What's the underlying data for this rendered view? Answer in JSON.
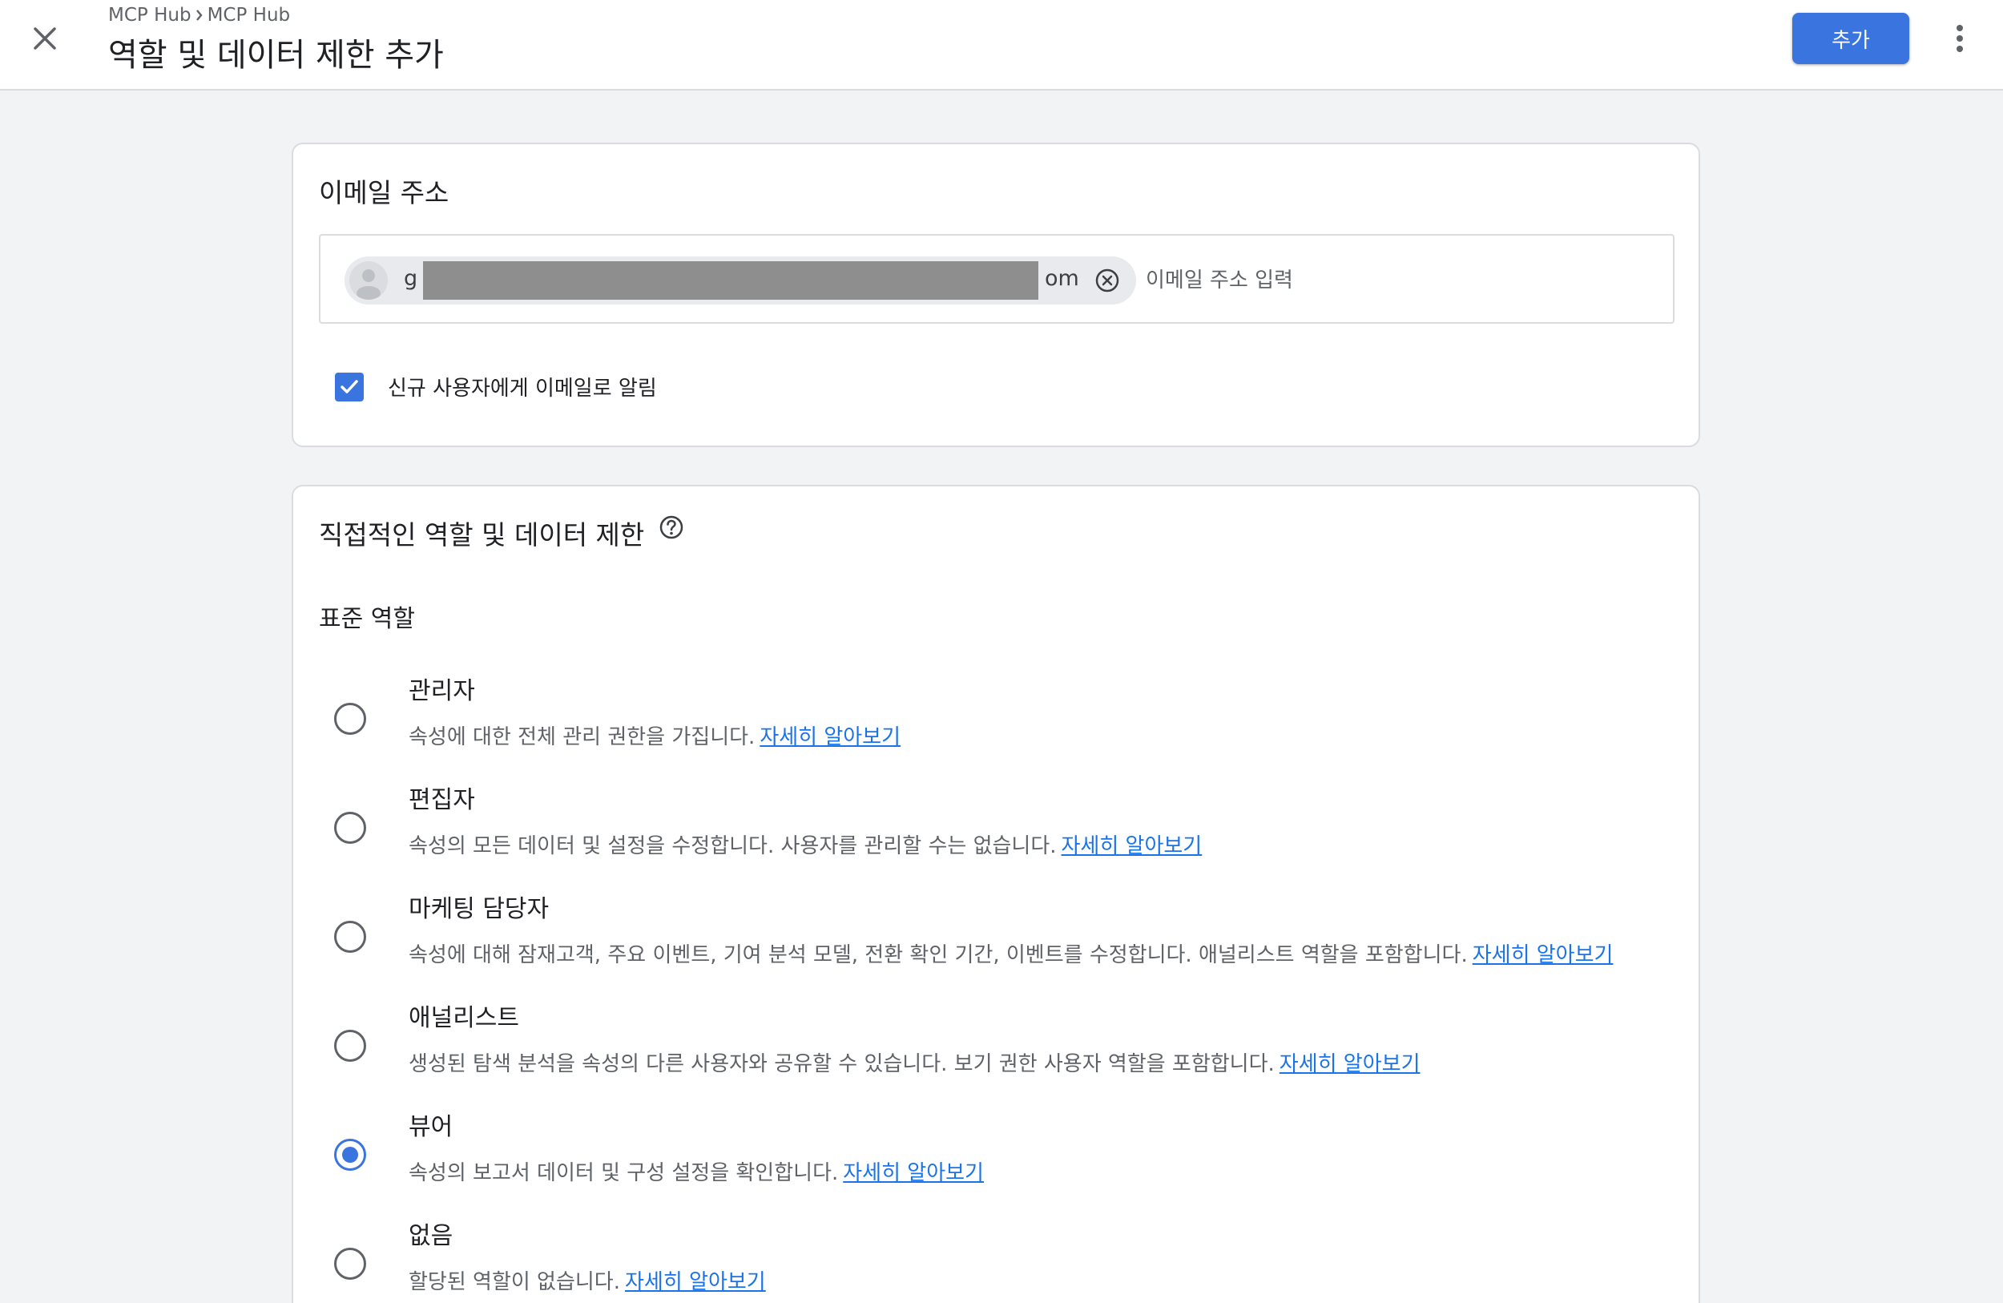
{
  "header": {
    "breadcrumb": [
      "MCP Hub",
      "MCP Hub"
    ],
    "title": "역할 및 데이터 제한 추가",
    "add_label": "추가"
  },
  "email_section": {
    "title": "이메일 주소",
    "chip": {
      "text_start": "g",
      "text_end": "om"
    },
    "placeholder": "이메일 주소 입력",
    "notify_label": "신규 사용자에게 이메일로 알림",
    "notify_checked": true
  },
  "roles_section": {
    "title": "직접적인 역할 및 데이터 제한",
    "subtitle": "표준 역할",
    "learn_more": "자세히 알아보기",
    "roles": [
      {
        "name": "관리자",
        "description": "속성에 대한 전체 관리 권한을 가집니다.",
        "selected": false
      },
      {
        "name": "편집자",
        "description": "속성의 모든 데이터 및 설정을 수정합니다. 사용자를 관리할 수는 없습니다.",
        "selected": false
      },
      {
        "name": "마케팅 담당자",
        "description": "속성에 대해 잠재고객, 주요 이벤트, 기여 분석 모델, 전환 확인 기간, 이벤트를 수정합니다. 애널리스트 역할을 포함합니다.",
        "selected": false
      },
      {
        "name": "애널리스트",
        "description": "생성된 탐색 분석을 속성의 다른 사용자와 공유할 수 있습니다. 보기 권한 사용자 역할을 포함합니다.",
        "selected": false
      },
      {
        "name": "뷰어",
        "description": "속성의 보고서 데이터 및 구성 설정을 확인합니다.",
        "selected": true
      },
      {
        "name": "없음",
        "description": "할당된 역할이 없습니다.",
        "selected": false
      }
    ]
  },
  "colors": {
    "accent": "#3a74df",
    "link": "#1a73e8",
    "background": "#f1f3f4"
  }
}
